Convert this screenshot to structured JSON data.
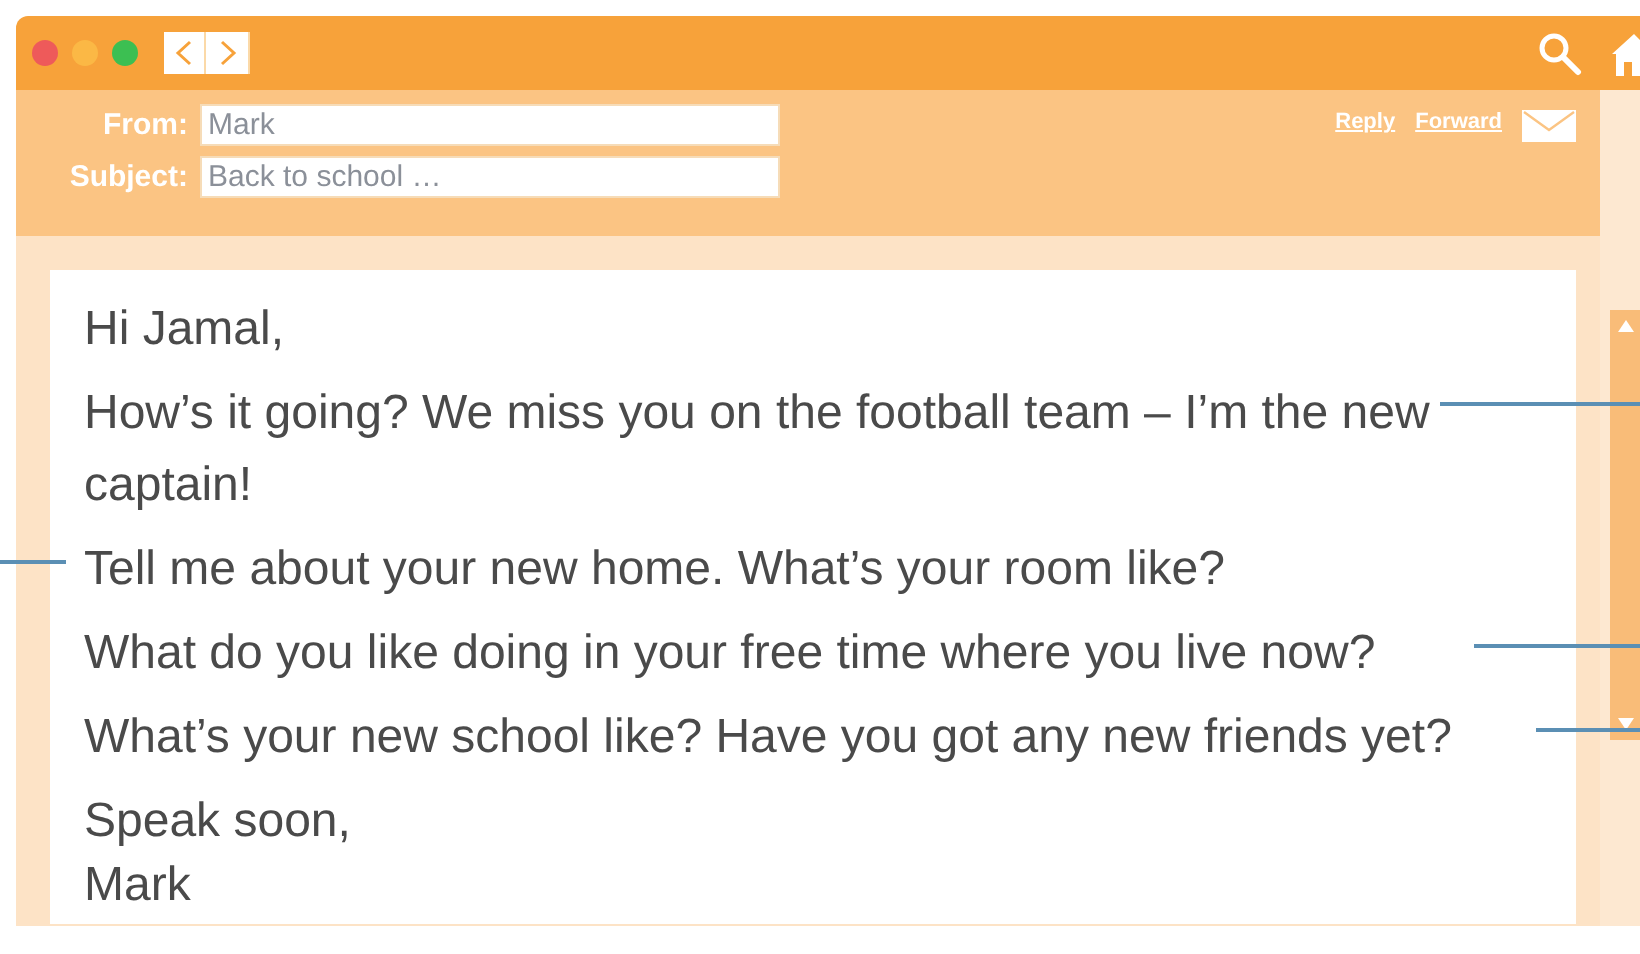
{
  "header": {
    "from": {
      "label": "From:",
      "value": "Mark"
    },
    "subject": {
      "label": "Subject:",
      "value": "Back to school …"
    },
    "actions": [
      "Reply",
      "Forward"
    ]
  },
  "message": {
    "greeting": "Hi Jamal,",
    "paragraphs": [
      {
        "text": "How’s it going? We miss you on the football team – I’m the new captain!"
      },
      {
        "text": "Tell me about your new home. What’s your room like?"
      },
      {
        "text": "What do you like doing in your free time where you live now?"
      },
      {
        "text": "What’s your new school like? Have you got any new friends yet?"
      }
    ],
    "closing": "Speak soon,",
    "signature": "Mark"
  }
}
